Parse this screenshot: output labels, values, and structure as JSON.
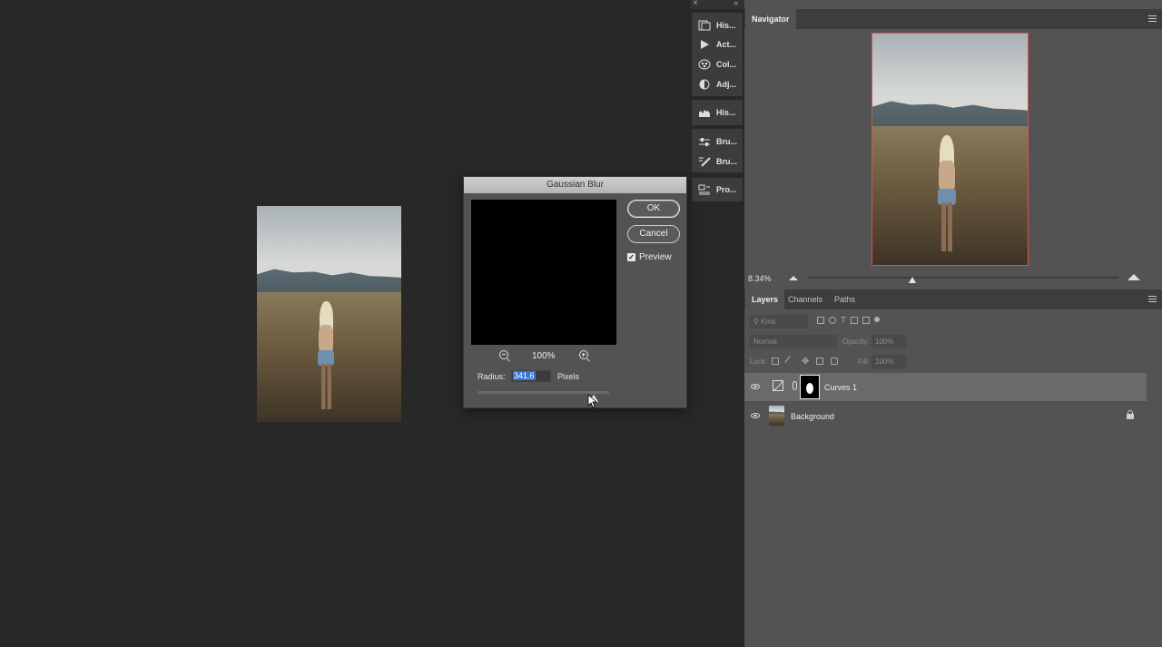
{
  "strip": {
    "close_icon": "×",
    "collapse_icon": "»",
    "items": [
      {
        "label": "His...",
        "icon": "history-icon"
      },
      {
        "label": "Act...",
        "icon": "actions-icon"
      },
      {
        "label": "Col...",
        "icon": "color-icon"
      },
      {
        "label": "Adj...",
        "icon": "adjustments-icon"
      },
      {
        "label": "His...",
        "icon": "histogram-icon"
      },
      {
        "label": "Bru...",
        "icon": "brush-settings-icon"
      },
      {
        "label": "Bru...",
        "icon": "brushes-icon"
      },
      {
        "label": "Pro...",
        "icon": "properties-icon"
      }
    ]
  },
  "navigator": {
    "tab": "Navigator",
    "zoom": "8.34%",
    "zoom_fraction": 0.34
  },
  "layers_panel": {
    "tabs": [
      "Layers",
      "Channels",
      "Paths"
    ],
    "kind_placeholder": "Kind",
    "blend_mode": "Normal",
    "opacity_label": "Opacity:",
    "opacity_value": "100%",
    "lock_label": "Lock:",
    "fill_label": "Fill:",
    "fill_value": "100%",
    "layers": [
      {
        "name": "Curves 1",
        "selected": true
      },
      {
        "name": "Background",
        "locked": true
      }
    ]
  },
  "dialog": {
    "title": "Gaussian Blur",
    "ok": "OK",
    "cancel": "Cancel",
    "preview_label": "Preview",
    "preview_checked": true,
    "zoom": "100%",
    "radius_label": "Radius:",
    "radius_value": "341.6",
    "units": "Pixels",
    "radius_fraction": 0.85
  },
  "colors": {
    "canvas_bg": "#282828",
    "panel_bg": "#535353",
    "selection": "#3875d7",
    "nav_frame": "#d9534f"
  }
}
